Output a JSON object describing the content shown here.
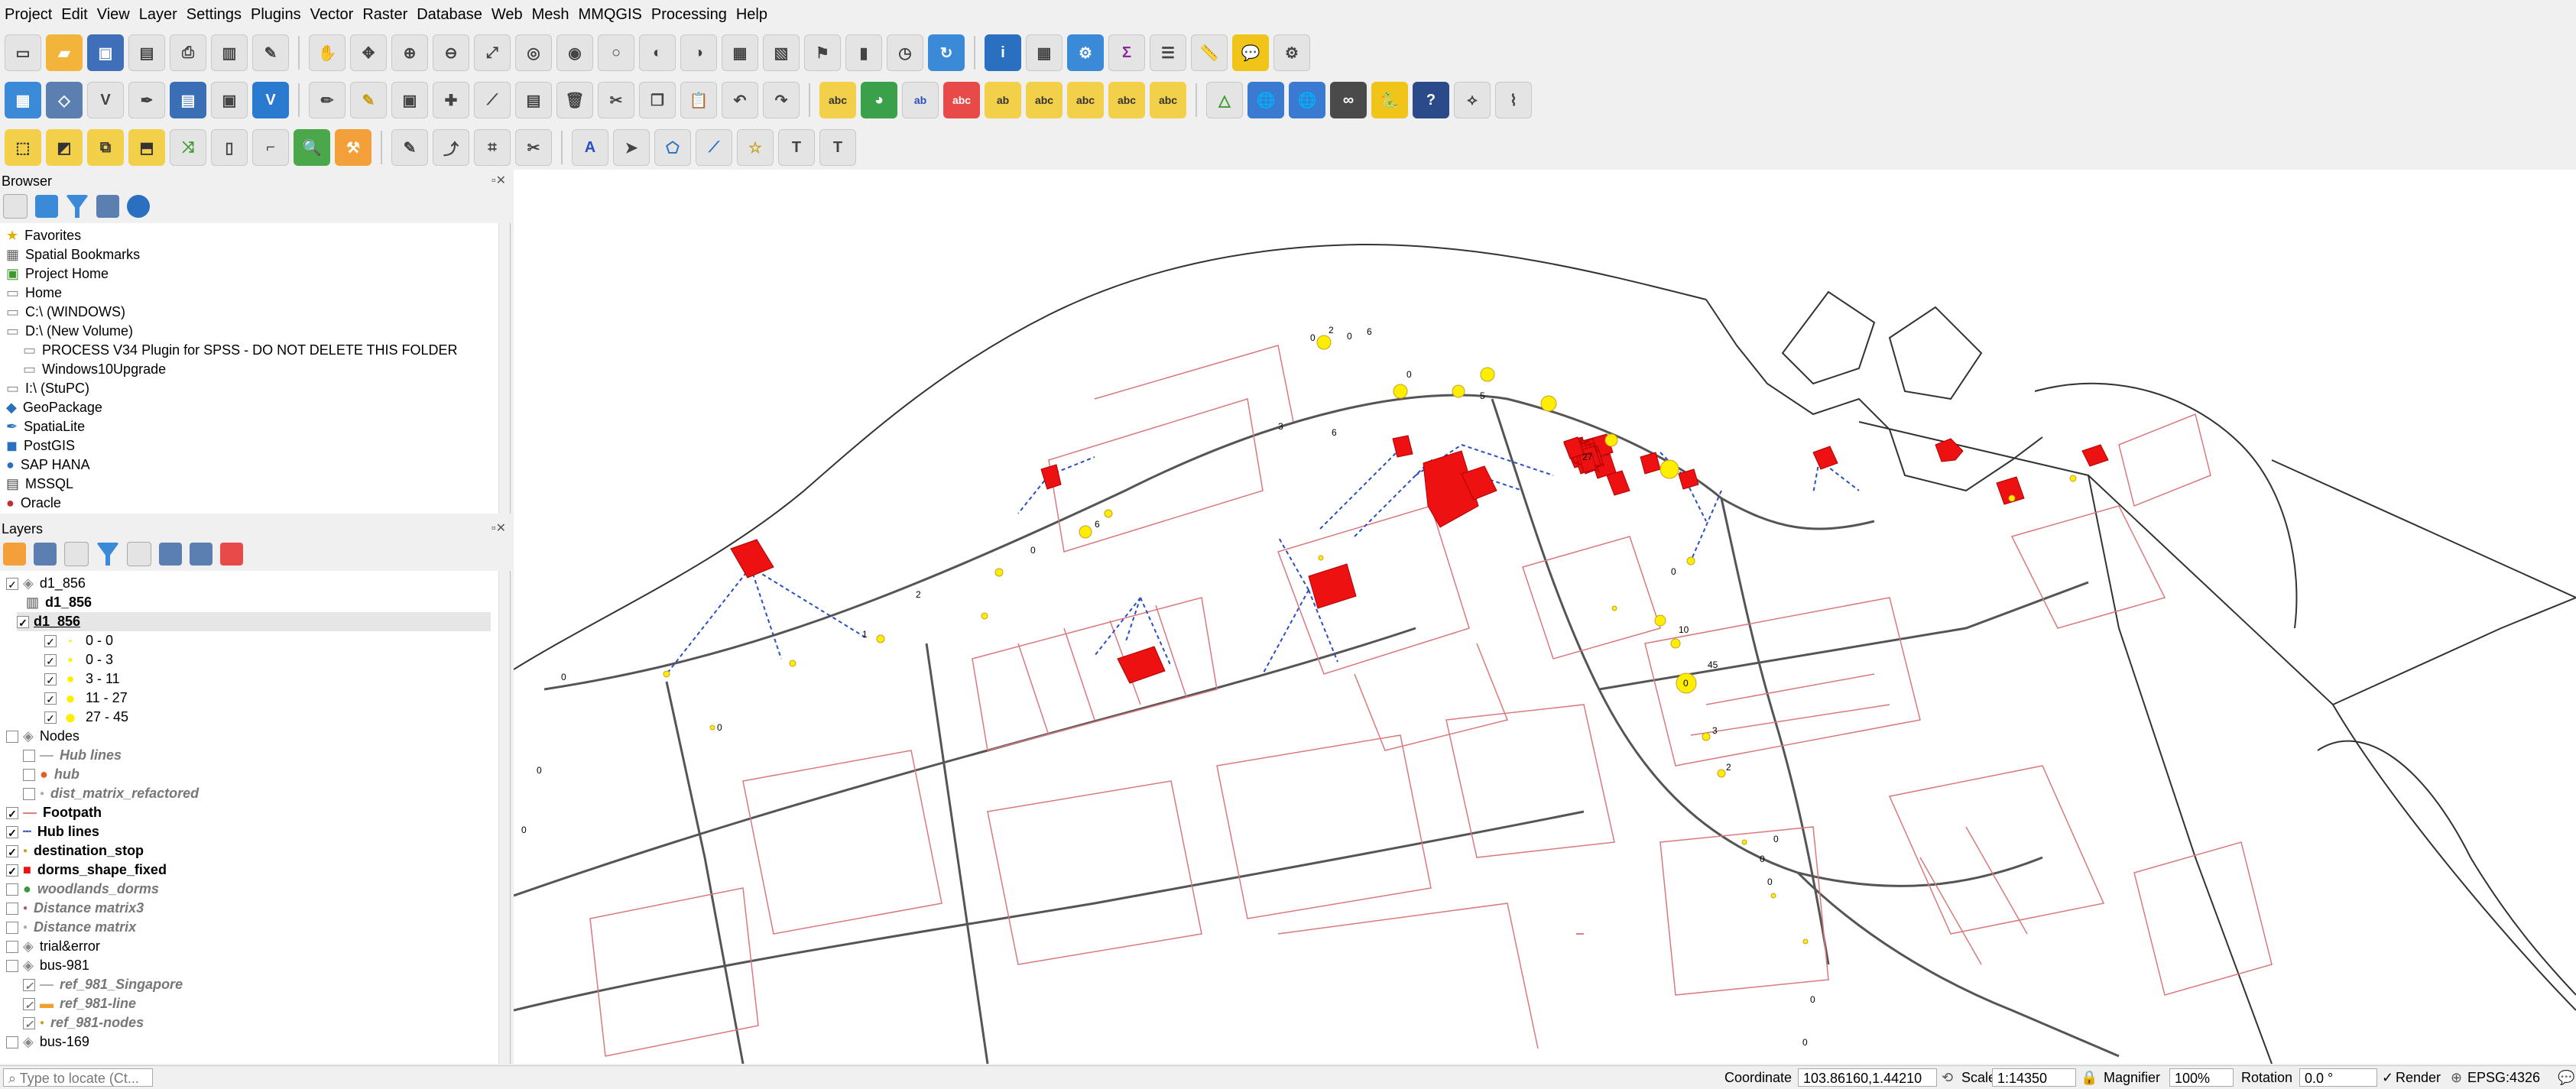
{
  "menu": [
    "Project",
    "Edit",
    "View",
    "Layer",
    "Settings",
    "Plugins",
    "Vector",
    "Raster",
    "Database",
    "Web",
    "Mesh",
    "MMQGIS",
    "Processing",
    "Help"
  ],
  "browser": {
    "title": "Browser",
    "items": [
      "Favorites",
      "Spatial Bookmarks",
      "Project Home",
      "Home",
      "C:\\ (WINDOWS)",
      "D:\\ (New Volume)",
      "PROCESS V34 Plugin for SPSS - DO NOT DELETE THIS FOLDER",
      "Windows10Upgrade",
      "I:\\ (StuPC)",
      "GeoPackage",
      "SpatiaLite",
      "PostGIS",
      "SAP HANA",
      "MSSQL",
      "Oracle"
    ]
  },
  "layers": {
    "title": "Layers",
    "items": [
      {
        "label": "d1_856",
        "style": "normal"
      },
      {
        "label": "d1_856",
        "style": "bold"
      },
      {
        "label": "d1_856",
        "style": "boldunder"
      },
      {
        "label": "0 - 0",
        "style": "legend"
      },
      {
        "label": "0 - 3",
        "style": "legend"
      },
      {
        "label": "3 - 11",
        "style": "legend"
      },
      {
        "label": "11 - 27",
        "style": "legend"
      },
      {
        "label": "27 - 45",
        "style": "legend"
      },
      {
        "label": "Nodes",
        "style": "normal"
      },
      {
        "label": "Hub lines",
        "style": "italic"
      },
      {
        "label": "hub",
        "style": "italic"
      },
      {
        "label": "dist_matrix_refactored",
        "style": "italic"
      },
      {
        "label": "Footpath",
        "style": "bold"
      },
      {
        "label": "Hub lines",
        "style": "bold"
      },
      {
        "label": "destination_stop",
        "style": "bold"
      },
      {
        "label": "dorms_shape_fixed",
        "style": "bold"
      },
      {
        "label": "woodlands_dorms",
        "style": "italic"
      },
      {
        "label": "Distance matrix3",
        "style": "italic"
      },
      {
        "label": "Distance matrix",
        "style": "italic"
      },
      {
        "label": "trial&error",
        "style": "normal"
      },
      {
        "label": "bus-981",
        "style": "normal"
      },
      {
        "label": "ref_981_Singapore",
        "style": "italic"
      },
      {
        "label": "ref_981-line",
        "style": "italic"
      },
      {
        "label": "ref_981-nodes",
        "style": "italic"
      },
      {
        "label": "bus-169",
        "style": "normal"
      }
    ]
  },
  "map_labels": [
    "0",
    "2",
    "0",
    "6",
    "0",
    "3",
    "6",
    "5",
    "27",
    "1",
    "0",
    "2",
    "6",
    "0",
    "0",
    "10",
    "45",
    "0",
    "3",
    "2",
    "0",
    "0",
    "0",
    "0",
    "0",
    "0",
    "0",
    "0"
  ],
  "locator": {
    "placeholder": "Type to locate (Ct..."
  },
  "status": {
    "coordinate_label": "Coordinate",
    "coordinate_value": "103.86160,1.44210",
    "scale_label": "Scale",
    "scale_value": "1:14350",
    "magnifier_label": "Magnifier",
    "magnifier_value": "100%",
    "rotation_label": "Rotation",
    "rotation_value": "0.0 °",
    "render_label": "Render",
    "crs": "EPSG:4326"
  },
  "colors": {
    "roads": "#d9797c",
    "points": "#ffee00",
    "dorms": "#ee1111",
    "hubline": "#2a4fc0"
  }
}
